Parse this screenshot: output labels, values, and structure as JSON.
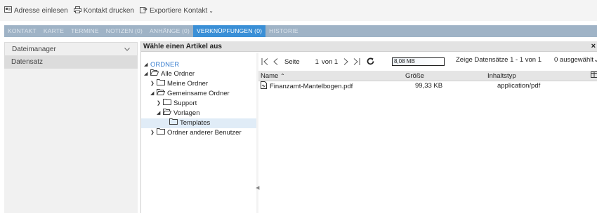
{
  "toolbar": {
    "items": [
      {
        "label": "Adresse einlesen",
        "icon": "id-card-icon"
      },
      {
        "label": "Kontakt drucken",
        "icon": "printer-icon"
      },
      {
        "label": "Exportiere Kontakt",
        "icon": "export-icon"
      }
    ]
  },
  "tabs": [
    {
      "label": "KONTAKT",
      "active": false
    },
    {
      "label": "KARTE",
      "active": false
    },
    {
      "label": "TERMINE",
      "active": false
    },
    {
      "label": "NOTIZEN (0)",
      "active": false
    },
    {
      "label": "ANHÄNGE (0)",
      "active": false
    },
    {
      "label": "VERKNÜPFUNGEN (0)",
      "active": true
    },
    {
      "label": "HISTORIE",
      "active": false
    }
  ],
  "left": {
    "dropdown_value": "Dateimanager",
    "row_label": "Datensatz"
  },
  "dialog": {
    "title": "Wähle einen Artikel aus",
    "close": "×"
  },
  "tree": {
    "root": "ORDNER",
    "all_folders": "Alle Ordner",
    "my_folders": "Meine Ordner",
    "shared_folders": "Gemeinsame Ordner",
    "support": "Support",
    "vorlagen": "Vorlagen",
    "templates": "Templates",
    "other_users": "Ordner anderer Benutzer"
  },
  "pager": {
    "page_label": "Seite",
    "page_current": "1",
    "page_of": "von 1",
    "size_used": "8,08 MB",
    "records_text": "Zeige Datensätze 1 - 1 von 1",
    "selected_text": "0 ausgewählt"
  },
  "table": {
    "headers": {
      "name": "Name",
      "size": "Größe",
      "type": "Inhaltstyp"
    },
    "rows": [
      {
        "name": "Finanzamt-Mantelbogen.pdf",
        "size": "99,33 KB",
        "type": "application/pdf"
      }
    ]
  },
  "colors": {
    "active_tab": "#3a8fd6",
    "tab_bar": "#9fb3c6",
    "tree_root": "#3a7fd0",
    "selection": "#e0ecf7"
  }
}
